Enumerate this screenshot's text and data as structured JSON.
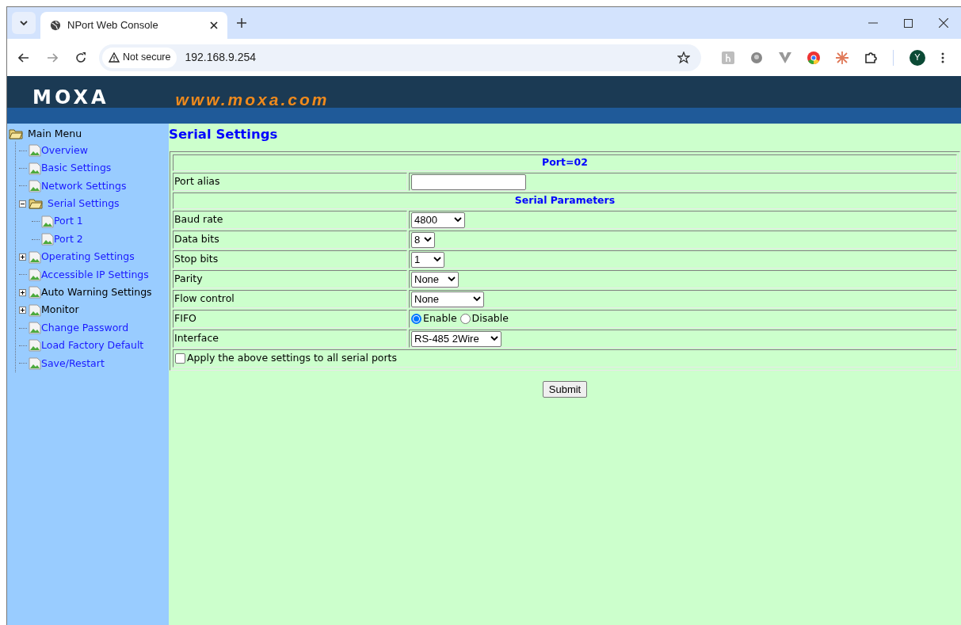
{
  "browser": {
    "tab_title": "NPort Web Console",
    "security_label": "Not secure",
    "url": "192.168.9.254",
    "profile_initial": "Y"
  },
  "banner": {
    "logo": "MOXA",
    "site": "www.moxa.com"
  },
  "sidebar": {
    "root": "Main Menu",
    "items": [
      {
        "label": "Overview",
        "kind": "page",
        "is_link": true
      },
      {
        "label": "Basic Settings",
        "kind": "page",
        "is_link": true
      },
      {
        "label": "Network Settings",
        "kind": "page",
        "is_link": true
      },
      {
        "label": "Serial Settings",
        "kind": "folder",
        "is_link": true,
        "expanded": true,
        "children": [
          {
            "label": "Port 1",
            "kind": "page",
            "is_link": true
          },
          {
            "label": "Port 2",
            "kind": "page",
            "is_link": true
          }
        ]
      },
      {
        "label": "Operating Settings",
        "kind": "page",
        "is_link": true,
        "expanded": false
      },
      {
        "label": "Accessible IP Settings",
        "kind": "page",
        "is_link": true
      },
      {
        "label": "Auto Warning Settings",
        "kind": "page",
        "is_link": false,
        "expanded": false
      },
      {
        "label": "Monitor",
        "kind": "page",
        "is_link": false,
        "expanded": false
      },
      {
        "label": "Change Password",
        "kind": "page",
        "is_link": true
      },
      {
        "label": "Load Factory Default",
        "kind": "page",
        "is_link": true
      },
      {
        "label": "Save/Restart",
        "kind": "page",
        "is_link": true
      }
    ]
  },
  "page_title": "Serial Settings",
  "form": {
    "rows": [
      {
        "kind": "header",
        "text": "Port=02"
      },
      {
        "kind": "input",
        "label": "Port alias"
      },
      {
        "kind": "header",
        "text": "Serial Parameters"
      },
      {
        "kind": "select",
        "label": "Baud rate",
        "value": "4800"
      },
      {
        "kind": "select",
        "label": "Data bits",
        "value": "8"
      },
      {
        "kind": "select",
        "label": "Stop bits",
        "value": "1"
      },
      {
        "kind": "select",
        "label": "Parity",
        "value": "None"
      },
      {
        "kind": "select",
        "label": "Flow control",
        "value": "None"
      },
      {
        "kind": "radio",
        "label": "FIFO",
        "options": [
          {
            "label": "Enable",
            "selected": true
          },
          {
            "label": "Disable",
            "selected": false
          }
        ]
      },
      {
        "kind": "select",
        "label": "Interface",
        "value": "RS-485 2Wire"
      },
      {
        "kind": "checkbox",
        "label": "Apply the above settings to all serial ports",
        "checked": false
      }
    ],
    "submit": "Submit"
  }
}
